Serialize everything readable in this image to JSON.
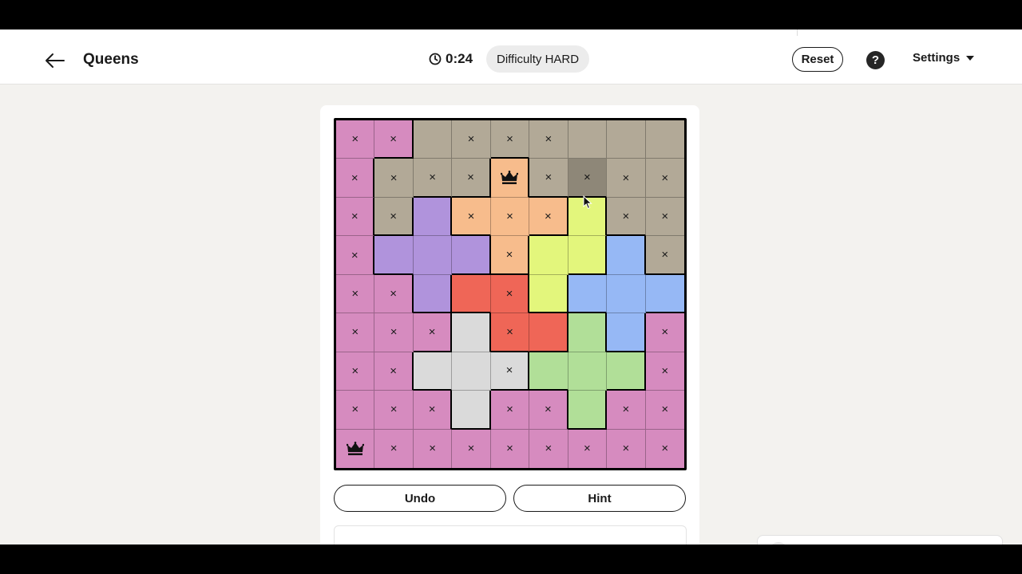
{
  "header": {
    "title": "Queens",
    "timer": "0:24",
    "difficulty": "Difficulty HARD",
    "reset_label": "Reset",
    "help_label": "?",
    "settings_label": "Settings"
  },
  "board": {
    "size": 9,
    "colors": {
      "pink": "#d68bbf",
      "taupe": "#b2a997",
      "orange": "#f7bc8c",
      "purple": "#b093dc",
      "yellow": "#e3f67c",
      "blue": "#96b8f5",
      "red": "#ef6657",
      "gray": "#dadada",
      "green": "#b1df98"
    },
    "regions": [
      [
        "pink",
        "pink",
        "taupe",
        "taupe",
        "taupe",
        "taupe",
        "taupe",
        "taupe",
        "taupe"
      ],
      [
        "pink",
        "taupe",
        "taupe",
        "taupe",
        "orange",
        "taupe",
        "taupe",
        "taupe",
        "taupe"
      ],
      [
        "pink",
        "taupe",
        "purple",
        "orange",
        "orange",
        "orange",
        "yellow",
        "taupe",
        "taupe"
      ],
      [
        "pink",
        "purple",
        "purple",
        "purple",
        "orange",
        "yellow",
        "yellow",
        "blue",
        "taupe"
      ],
      [
        "pink",
        "pink",
        "purple",
        "red",
        "red",
        "yellow",
        "blue",
        "blue",
        "blue"
      ],
      [
        "pink",
        "pink",
        "pink",
        "gray",
        "red",
        "red",
        "green",
        "blue",
        "pink"
      ],
      [
        "pink",
        "pink",
        "gray",
        "gray",
        "gray",
        "green",
        "green",
        "green",
        "pink"
      ],
      [
        "pink",
        "pink",
        "pink",
        "gray",
        "pink",
        "pink",
        "green",
        "pink",
        "pink"
      ],
      [
        "pink",
        "pink",
        "pink",
        "pink",
        "pink",
        "pink",
        "pink",
        "pink",
        "pink"
      ]
    ],
    "states": [
      [
        "x",
        "x",
        "",
        "x",
        "x",
        "x",
        "",
        "",
        ""
      ],
      [
        "x",
        "x",
        "x",
        "x",
        "Q",
        "x",
        "x",
        "x",
        "x"
      ],
      [
        "x",
        "x",
        "",
        "x",
        "x",
        "x",
        "",
        "x",
        "x"
      ],
      [
        "x",
        "",
        "",
        "",
        "x",
        "",
        "",
        "",
        "x"
      ],
      [
        "x",
        "x",
        "",
        "",
        "x",
        "",
        "",
        "",
        ""
      ],
      [
        "x",
        "x",
        "x",
        "",
        "x",
        "",
        "",
        "",
        "x"
      ],
      [
        "x",
        "x",
        "",
        "",
        "x",
        "",
        "",
        "",
        "x"
      ],
      [
        "x",
        "x",
        "x",
        "",
        "x",
        "x",
        "",
        "x",
        "x"
      ],
      [
        "Q",
        "x",
        "x",
        "x",
        "x",
        "x",
        "x",
        "x",
        "x"
      ]
    ],
    "hovered_cell": [
      1,
      6
    ]
  },
  "actions": {
    "undo_label": "Undo",
    "hint_label": "Hint"
  }
}
